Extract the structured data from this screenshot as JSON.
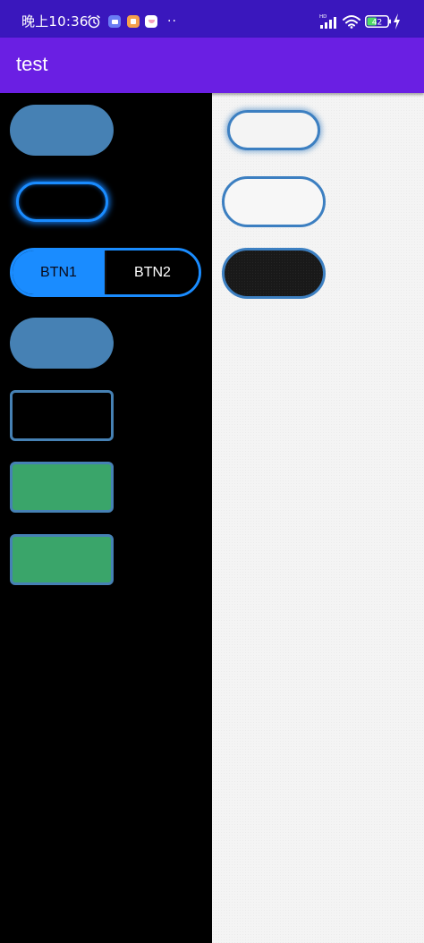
{
  "status_bar": {
    "time": "晚上10:36",
    "network_label": "HD",
    "battery_level": "42",
    "icons": [
      "alarm-icon",
      "app-notification-icon",
      "app-notification-icon",
      "app-notification-icon",
      "more-dots-icon",
      "signal-icon",
      "wifi-icon",
      "battery-icon",
      "charging-icon"
    ],
    "dots": "··"
  },
  "app_bar": {
    "title": "test"
  },
  "segmented_control": {
    "options": [
      {
        "label": "BTN1",
        "selected": true
      },
      {
        "label": "BTN2",
        "selected": false
      }
    ]
  },
  "colors": {
    "status_bar": "#3a17bd",
    "app_bar": "#6a1fe3",
    "accent_blue": "#1a8cff",
    "button_blue": "#4681b4",
    "button_green": "#3aa56a",
    "left_background": "#000000",
    "right_background": "#f4f4f4"
  }
}
